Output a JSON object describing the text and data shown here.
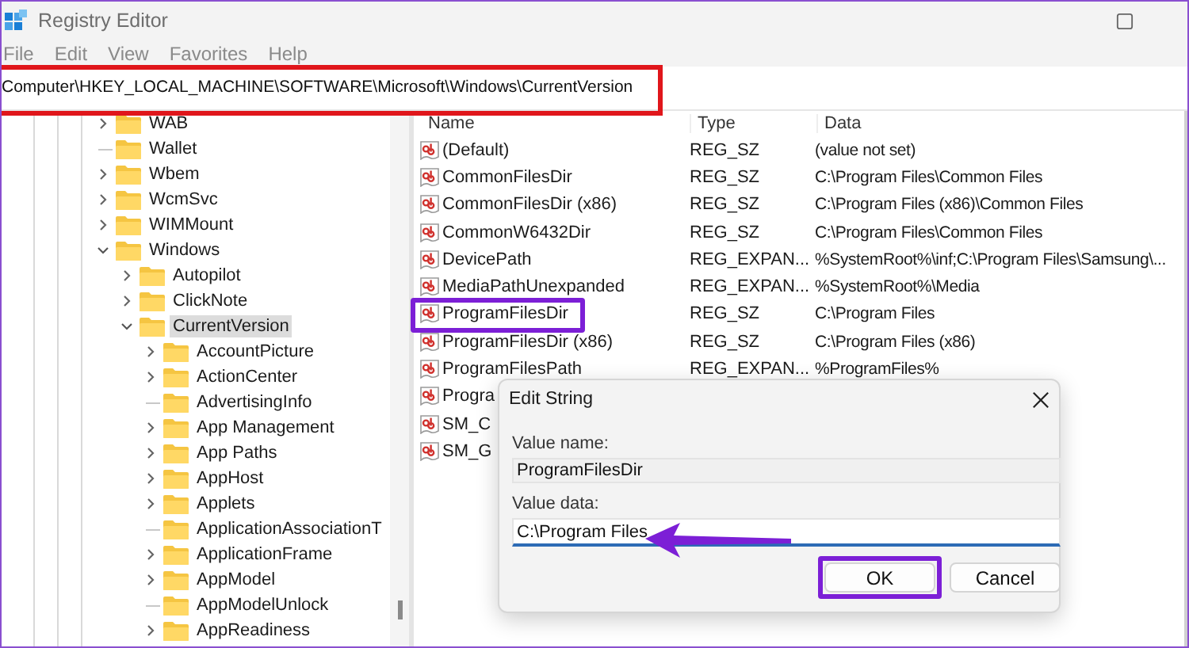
{
  "window": {
    "title": "Registry Editor"
  },
  "menu": [
    "File",
    "Edit",
    "View",
    "Favorites",
    "Help"
  ],
  "address": "Computer\\HKEY_LOCAL_MACHINE\\SOFTWARE\\Microsoft\\Windows\\CurrentVersion",
  "tree": [
    {
      "label": "WAB",
      "expandable": true,
      "expanded": false,
      "selected": false
    },
    {
      "label": "Wallet",
      "expandable": false,
      "expanded": false,
      "selected": false
    },
    {
      "label": "Wbem",
      "expandable": true,
      "expanded": false,
      "selected": false
    },
    {
      "label": "WcmSvc",
      "expandable": true,
      "expanded": false,
      "selected": false
    },
    {
      "label": "WIMMount",
      "expandable": true,
      "expanded": false,
      "selected": false
    },
    {
      "label": "Windows",
      "expandable": true,
      "expanded": true,
      "selected": false,
      "children": [
        {
          "label": "Autopilot",
          "expandable": true,
          "expanded": false,
          "selected": false
        },
        {
          "label": "ClickNote",
          "expandable": true,
          "expanded": false,
          "selected": false
        },
        {
          "label": "CurrentVersion",
          "expandable": true,
          "expanded": true,
          "selected": true,
          "children": [
            {
              "label": "AccountPicture",
              "expandable": true,
              "expanded": false,
              "selected": false
            },
            {
              "label": "ActionCenter",
              "expandable": true,
              "expanded": false,
              "selected": false
            },
            {
              "label": "AdvertisingInfo",
              "expandable": false,
              "expanded": false,
              "selected": false
            },
            {
              "label": "App Management",
              "expandable": true,
              "expanded": false,
              "selected": false
            },
            {
              "label": "App Paths",
              "expandable": true,
              "expanded": false,
              "selected": false
            },
            {
              "label": "AppHost",
              "expandable": true,
              "expanded": false,
              "selected": false
            },
            {
              "label": "Applets",
              "expandable": true,
              "expanded": false,
              "selected": false
            },
            {
              "label": "ApplicationAssociationT",
              "expandable": false,
              "expanded": false,
              "selected": false
            },
            {
              "label": "ApplicationFrame",
              "expandable": true,
              "expanded": false,
              "selected": false
            },
            {
              "label": "AppModel",
              "expandable": true,
              "expanded": false,
              "selected": false
            },
            {
              "label": "AppModelUnlock",
              "expandable": false,
              "expanded": false,
              "selected": false
            },
            {
              "label": "AppReadiness",
              "expandable": true,
              "expanded": false,
              "selected": false
            }
          ]
        }
      ]
    }
  ],
  "table": {
    "columns": [
      "Name",
      "Type",
      "Data"
    ],
    "rows": [
      {
        "name": "(Default)",
        "type": "REG_SZ",
        "data": "(value not set)",
        "highlighted": false
      },
      {
        "name": "CommonFilesDir",
        "type": "REG_SZ",
        "data": "C:\\Program Files\\Common Files",
        "highlighted": false
      },
      {
        "name": "CommonFilesDir (x86)",
        "type": "REG_SZ",
        "data": "C:\\Program Files (x86)\\Common Files",
        "highlighted": false
      },
      {
        "name": "CommonW6432Dir",
        "type": "REG_SZ",
        "data": "C:\\Program Files\\Common Files",
        "highlighted": false
      },
      {
        "name": "DevicePath",
        "type": "REG_EXPAN...",
        "data": "%SystemRoot%\\inf;C:\\Program Files\\Samsung\\...",
        "highlighted": false
      },
      {
        "name": "MediaPathUnexpanded",
        "type": "REG_EXPAN...",
        "data": "%SystemRoot%\\Media",
        "highlighted": false
      },
      {
        "name": "ProgramFilesDir",
        "type": "REG_SZ",
        "data": "C:\\Program Files",
        "highlighted": true
      },
      {
        "name": "ProgramFilesDir (x86)",
        "type": "REG_SZ",
        "data": "C:\\Program Files (x86)",
        "highlighted": false
      },
      {
        "name": "ProgramFilesPath",
        "type": "REG_EXPAN...",
        "data": "%ProgramFiles%",
        "highlighted": false
      },
      {
        "name": "Progra",
        "highlighted": false
      },
      {
        "name": "SM_C",
        "highlighted": false
      },
      {
        "name": "SM_G",
        "highlighted": false
      }
    ]
  },
  "dialog": {
    "title": "Edit String",
    "value_name_label": "Value name:",
    "value_name": "ProgramFilesDir",
    "value_data_label": "Value data:",
    "value_data": "C:\\Program Files",
    "buttons": [
      {
        "label": "OK",
        "highlighted": true
      },
      {
        "label": "Cancel",
        "highlighted": false
      }
    ]
  },
  "annotations": {
    "address_box": true,
    "arrow": true
  }
}
